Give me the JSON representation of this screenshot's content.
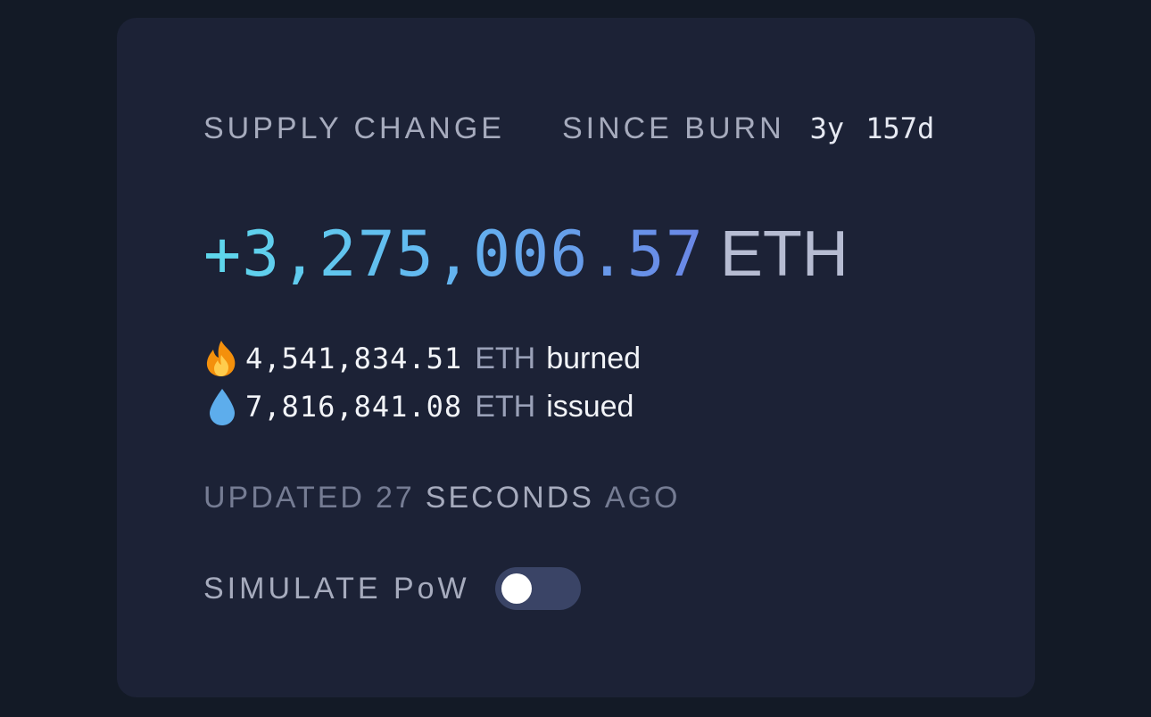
{
  "header": {
    "title": "SUPPLY CHANGE",
    "period_label": "SINCE BURN",
    "age_years": "3y",
    "age_days": "157d"
  },
  "supply_change": {
    "value": "+3,275,006.57",
    "unit": "ETH"
  },
  "burned": {
    "icon": "fire-icon",
    "value": "4,541,834.51",
    "unit": "ETH",
    "label": "burned"
  },
  "issued": {
    "icon": "droplet-icon",
    "value": "7,816,841.08",
    "unit": "ETH",
    "label": "issued"
  },
  "updated": {
    "prefix": "UPDATED",
    "count": "27",
    "unit": "SECONDS",
    "suffix": "AGO"
  },
  "simulate": {
    "label": "SIMULATE PoW",
    "enabled": false
  },
  "colors": {
    "background": "#131a26",
    "card": "#1c2236",
    "gradient_start": "#5ed8ec",
    "gradient_end": "#6a86e6",
    "toggle_track": "#3a4466"
  }
}
